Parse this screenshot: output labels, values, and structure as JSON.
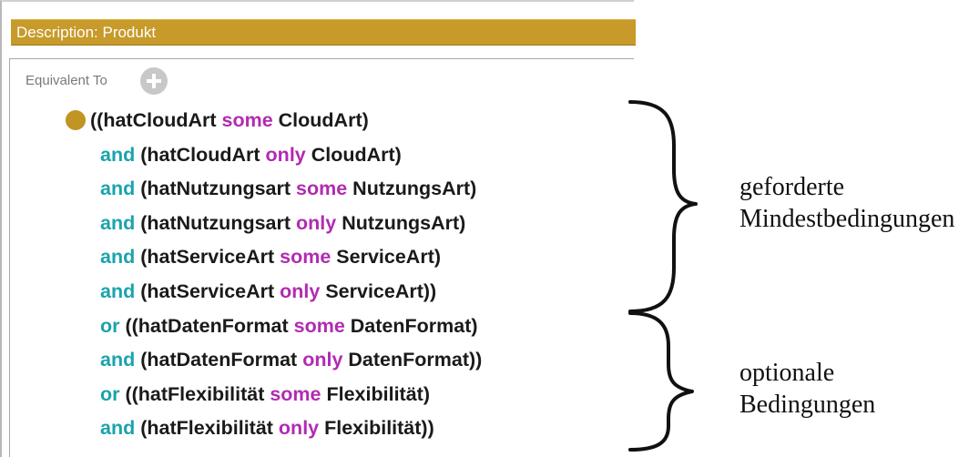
{
  "panel": {
    "title": "Description: Produkt",
    "section_label": "Equivalent To",
    "add_icon": "plus-circle-icon",
    "axiom_icon": "class-expression-dot-icon"
  },
  "axiom_lines": [
    [
      {
        "t": "((hatCloudArt ",
        "k": "text"
      },
      {
        "t": "some",
        "k": "quant"
      },
      {
        "t": " CloudArt)",
        "k": "text"
      }
    ],
    [
      {
        "t": "and",
        "k": "logic"
      },
      {
        "t": " (hatCloudArt ",
        "k": "text"
      },
      {
        "t": "only",
        "k": "quant"
      },
      {
        "t": " CloudArt)",
        "k": "text"
      }
    ],
    [
      {
        "t": "and",
        "k": "logic"
      },
      {
        "t": " (hatNutzungsart ",
        "k": "text"
      },
      {
        "t": "some",
        "k": "quant"
      },
      {
        "t": " NutzungsArt)",
        "k": "text"
      }
    ],
    [
      {
        "t": "and",
        "k": "logic"
      },
      {
        "t": " (hatNutzungsart ",
        "k": "text"
      },
      {
        "t": "only",
        "k": "quant"
      },
      {
        "t": " NutzungsArt)",
        "k": "text"
      }
    ],
    [
      {
        "t": "and",
        "k": "logic"
      },
      {
        "t": " (hatServiceArt ",
        "k": "text"
      },
      {
        "t": "some",
        "k": "quant"
      },
      {
        "t": " ServiceArt)",
        "k": "text"
      }
    ],
    [
      {
        "t": "and",
        "k": "logic"
      },
      {
        "t": " (hatServiceArt ",
        "k": "text"
      },
      {
        "t": "only",
        "k": "quant"
      },
      {
        "t": " ServiceArt))",
        "k": "text"
      }
    ],
    [
      {
        "t": "or",
        "k": "logic"
      },
      {
        "t": " ((hatDatenFormat ",
        "k": "text"
      },
      {
        "t": "some",
        "k": "quant"
      },
      {
        "t": " DatenFormat)",
        "k": "text"
      }
    ],
    [
      {
        "t": "and",
        "k": "logic"
      },
      {
        "t": " (hatDatenFormat ",
        "k": "text"
      },
      {
        "t": "only",
        "k": "quant"
      },
      {
        "t": " DatenFormat))",
        "k": "text"
      }
    ],
    [
      {
        "t": "or",
        "k": "logic"
      },
      {
        "t": " ((hatFlexibilität ",
        "k": "text"
      },
      {
        "t": "some",
        "k": "quant"
      },
      {
        "t": " Flexibilität)",
        "k": "text"
      }
    ],
    [
      {
        "t": "and",
        "k": "logic"
      },
      {
        "t": "  (hatFlexibilität ",
        "k": "text"
      },
      {
        "t": "only",
        "k": "quant"
      },
      {
        "t": " Flexibilität))",
        "k": "text"
      }
    ]
  ],
  "annotations": {
    "required": {
      "line1": "geforderte",
      "line2": "Mindestbedingungen"
    },
    "optional": {
      "line1": "optionale",
      "line2": "Bedingungen"
    }
  },
  "colors": {
    "title_bar": "#c79a2a",
    "logic_keyword": "#1aa3ad",
    "quantifier_keyword": "#b12bb1",
    "class_text": "#1a1a1a",
    "axiom_dot": "#c19423"
  }
}
